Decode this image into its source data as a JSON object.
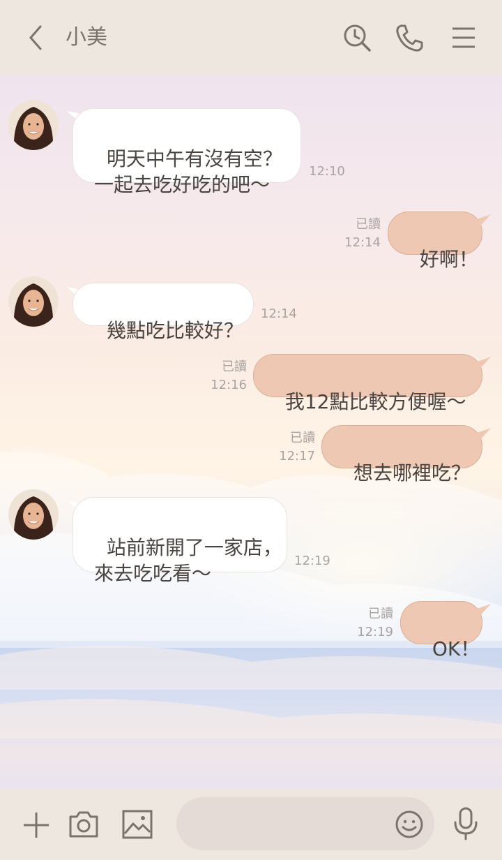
{
  "header": {
    "title": "小美",
    "icons": [
      "back-icon",
      "search-icon",
      "phone-icon",
      "menu-icon"
    ]
  },
  "messages": [
    {
      "side": "left",
      "text": "明天中午有沒有空？\n一起去吃好吃的吧～",
      "time": "12:10"
    },
    {
      "side": "right",
      "text": "好啊！",
      "read": "已讀",
      "time": "12:14"
    },
    {
      "side": "left",
      "text": "幾點吃比較好？",
      "time": "12:14"
    },
    {
      "side": "right",
      "text": "我12點比較方便喔～",
      "read": "已讀",
      "time": "12:16"
    },
    {
      "side": "right",
      "text": "想去哪裡吃？",
      "read": "已讀",
      "time": "12:17"
    },
    {
      "side": "left",
      "text": "站前新開了一家店，\n來去吃吃看～",
      "time": "12:19"
    },
    {
      "side": "right",
      "text": "OK！",
      "read": "已讀",
      "time": "12:19"
    }
  ],
  "footer": {
    "input_placeholder": "",
    "icons": [
      "plus-icon",
      "camera-icon",
      "image-icon",
      "emoji-icon",
      "mic-icon"
    ]
  },
  "colors": {
    "header_bg": "#eee7df",
    "incoming_bubble": "#ffffff",
    "outgoing_bubble": "#efc8b4",
    "text": "#4a4440",
    "meta_text": "#a9a3a2"
  }
}
